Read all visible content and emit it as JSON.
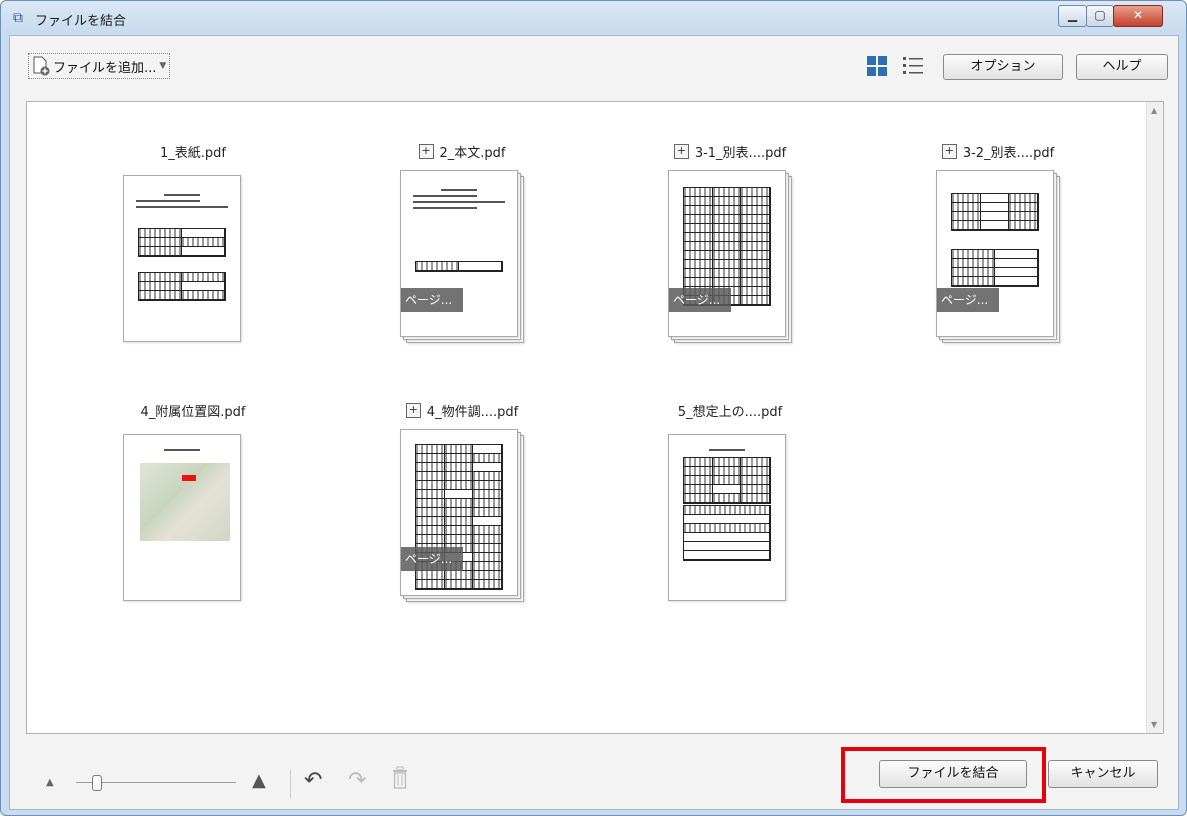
{
  "window": {
    "title": "ファイルを結合"
  },
  "toolbar": {
    "add_file_label": "ファイルを追加..."
  },
  "header_buttons": {
    "options": "オプション",
    "help": "ヘルプ"
  },
  "files": [
    {
      "name": "1_表紙.pdf",
      "expandable": false,
      "overlay": ""
    },
    {
      "name": "2_本文.pdf",
      "expandable": true,
      "overlay": "ページ..."
    },
    {
      "name": "3-1_別表....pdf",
      "expandable": true,
      "overlay": "ページ..."
    },
    {
      "name": "3-2_別表....pdf",
      "expandable": true,
      "overlay": "ページ..."
    },
    {
      "name": "4_附属位置図.pdf",
      "expandable": false,
      "overlay": ""
    },
    {
      "name": "4_物件調....pdf",
      "expandable": true,
      "overlay": "ページ..."
    },
    {
      "name": "5_想定上の....pdf",
      "expandable": false,
      "overlay": ""
    }
  ],
  "footer": {
    "combine_button": "ファイルを結合",
    "cancel_button": "キャンセル"
  },
  "zoom": {
    "level": 0.1
  },
  "colors": {
    "highlight": "#e8000b",
    "accent": "#2e6fb4"
  }
}
